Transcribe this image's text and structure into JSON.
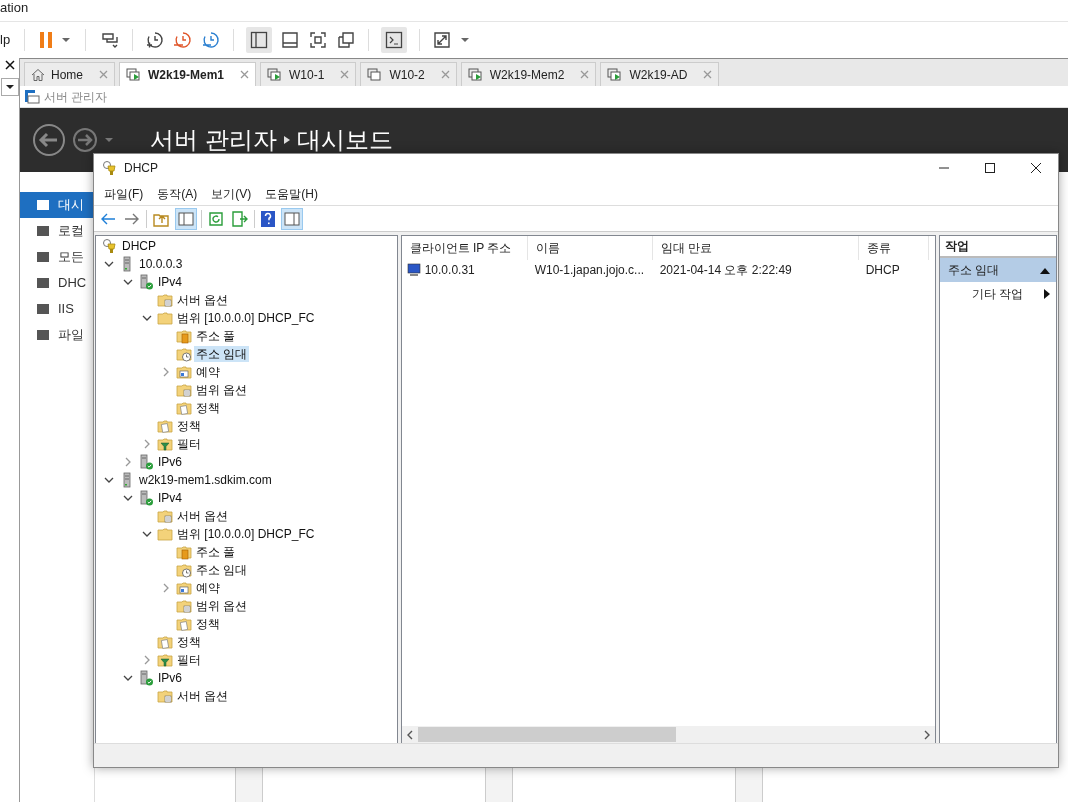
{
  "app_title": "ation",
  "menu_fragment": "lp",
  "vm_tabs": [
    {
      "label": "Home",
      "kind": "home",
      "selected": false
    },
    {
      "label": "W2k19-Mem1",
      "kind": "running",
      "selected": true
    },
    {
      "label": "W10-1",
      "kind": "running",
      "selected": false
    },
    {
      "label": "W10-2",
      "kind": "stopped",
      "selected": false
    },
    {
      "label": "W2k19-Mem2",
      "kind": "running",
      "selected": false
    },
    {
      "label": "W2k19-AD",
      "kind": "running",
      "selected": false
    }
  ],
  "server_manager": {
    "title": "서버 관리자",
    "breadcrumb": "서버 관리자",
    "current": "대시보드",
    "sidebar": [
      {
        "label": "대시",
        "selected": true
      },
      {
        "label": "로컬",
        "selected": false
      },
      {
        "label": "모든",
        "selected": false
      },
      {
        "label": "DHC",
        "selected": false
      },
      {
        "label": "IIS",
        "selected": false
      },
      {
        "label": "파일",
        "selected": false
      }
    ]
  },
  "dhcp_window": {
    "title": "DHCP",
    "menu": [
      "파일(F)",
      "동작(A)",
      "보기(V)",
      "도움말(H)"
    ],
    "tree": [
      {
        "label": "DHCP",
        "kind": "dhcp",
        "selected": false,
        "children": [
          {
            "label": "10.0.0.3",
            "kind": "server",
            "expanded": true,
            "selected": false,
            "children": [
              {
                "label": "IPv4",
                "kind": "ip",
                "expanded": true,
                "selected": false,
                "children": [
                  {
                    "label": "서버 옵션",
                    "kind": "options",
                    "selected": false
                  },
                  {
                    "label": "범위 [10.0.0.0] DHCP_FC",
                    "kind": "folder",
                    "expanded": true,
                    "selected": false,
                    "children": [
                      {
                        "label": "주소 풀",
                        "kind": "pool",
                        "selected": false
                      },
                      {
                        "label": "주소 임대",
                        "kind": "lease",
                        "selected": true
                      },
                      {
                        "label": "예약",
                        "kind": "reservation",
                        "expanded": false,
                        "selected": false
                      },
                      {
                        "label": "범위 옵션",
                        "kind": "options",
                        "selected": false
                      },
                      {
                        "label": "정책",
                        "kind": "policy",
                        "selected": false
                      }
                    ]
                  },
                  {
                    "label": "정책",
                    "kind": "policy",
                    "selected": false
                  },
                  {
                    "label": "필터",
                    "kind": "filter",
                    "expanded": false,
                    "selected": false
                  }
                ]
              },
              {
                "label": "IPv6",
                "kind": "ip",
                "expanded": false,
                "selected": false
              }
            ]
          },
          {
            "label": "w2k19-mem1.sdkim.com",
            "kind": "server",
            "expanded": true,
            "selected": false,
            "children": [
              {
                "label": "IPv4",
                "kind": "ip",
                "expanded": true,
                "selected": false,
                "children": [
                  {
                    "label": "서버 옵션",
                    "kind": "options",
                    "selected": false
                  },
                  {
                    "label": "범위 [10.0.0.0] DHCP_FC",
                    "kind": "folder",
                    "expanded": true,
                    "selected": false,
                    "children": [
                      {
                        "label": "주소 풀",
                        "kind": "pool",
                        "selected": false
                      },
                      {
                        "label": "주소 임대",
                        "kind": "lease",
                        "selected": false
                      },
                      {
                        "label": "예약",
                        "kind": "reservation",
                        "expanded": false,
                        "selected": false
                      },
                      {
                        "label": "범위 옵션",
                        "kind": "options",
                        "selected": false
                      },
                      {
                        "label": "정책",
                        "kind": "policy",
                        "selected": false
                      }
                    ]
                  },
                  {
                    "label": "정책",
                    "kind": "policy",
                    "selected": false
                  },
                  {
                    "label": "필터",
                    "kind": "filter",
                    "expanded": false,
                    "selected": false
                  }
                ]
              },
              {
                "label": "IPv6",
                "kind": "ip",
                "expanded": true,
                "selected": false,
                "children": [
                  {
                    "label": "서버 옵션",
                    "kind": "options",
                    "selected": false
                  }
                ]
              }
            ]
          }
        ]
      }
    ],
    "columns": [
      "클라이언트 IP 주소",
      "이름",
      "임대 만료",
      "종류"
    ],
    "rows": [
      {
        "cells": [
          "10.0.0.31",
          "W10-1.japan.jojo.c...",
          "2021-04-14 오후 2:22:49",
          "DHCP"
        ]
      }
    ],
    "actions": {
      "title": "작업",
      "items": [
        {
          "label": "주소 임대",
          "kind": "group",
          "selected": true
        },
        {
          "label": "기타 작업",
          "kind": "submenu",
          "selected": false
        }
      ]
    }
  }
}
